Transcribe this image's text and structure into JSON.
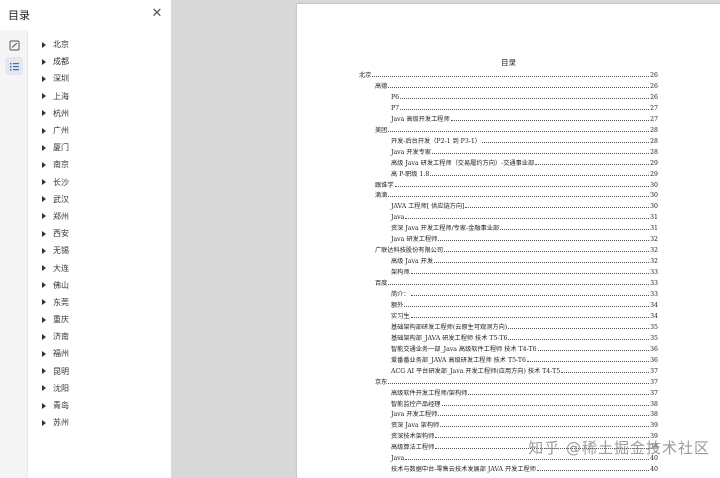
{
  "sidebar": {
    "title": "目录",
    "close_glyph": "✕",
    "tools": [
      {
        "icon": "thumbnail-icon",
        "active": false
      },
      {
        "icon": "outline-icon",
        "active": true
      }
    ],
    "items": [
      {
        "label": "北京"
      },
      {
        "label": "成都"
      },
      {
        "label": "深圳"
      },
      {
        "label": "上海"
      },
      {
        "label": "杭州"
      },
      {
        "label": "广州"
      },
      {
        "label": "厦门"
      },
      {
        "label": "南京"
      },
      {
        "label": "长沙"
      },
      {
        "label": "武汉"
      },
      {
        "label": "郑州"
      },
      {
        "label": "西安"
      },
      {
        "label": "无锡"
      },
      {
        "label": "大连"
      },
      {
        "label": "佛山"
      },
      {
        "label": "东莞"
      },
      {
        "label": "重庆"
      },
      {
        "label": "济南"
      },
      {
        "label": "福州"
      },
      {
        "label": "昆明"
      },
      {
        "label": "沈阳"
      },
      {
        "label": "青岛"
      },
      {
        "label": "苏州"
      }
    ]
  },
  "document": {
    "title": "目录",
    "entries": [
      {
        "text": "北京",
        "page": "26",
        "level": 0
      },
      {
        "text": "高德",
        "page": "26",
        "level": 1
      },
      {
        "text": "P6",
        "page": "26",
        "level": 2
      },
      {
        "text": "P7",
        "page": "27",
        "level": 2
      },
      {
        "text": "Java 高级开发工程师",
        "page": "27",
        "level": 2
      },
      {
        "text": "美团",
        "page": "28",
        "level": 1
      },
      {
        "text": "开发-后台开发（P2-1 到 P3-1）",
        "page": "28",
        "level": 2
      },
      {
        "text": "Java 开发专家",
        "page": "28",
        "level": 2
      },
      {
        "text": "高级 Java 研发工程师（交易履约方向）-交通事业部",
        "page": "29",
        "level": 2
      },
      {
        "text": "高 P-职级 1.8",
        "page": "29",
        "level": 2
      },
      {
        "text": "跟谁学",
        "page": "30",
        "level": 1
      },
      {
        "text": "滴滴",
        "page": "30",
        "level": 1
      },
      {
        "text": "JAVA 工程师[ 供应链方向]",
        "page": "30",
        "level": 2
      },
      {
        "text": "Java",
        "page": "31",
        "level": 2
      },
      {
        "text": "资深 Java 开发工程师/专家-金融事业部",
        "page": "31",
        "level": 2
      },
      {
        "text": "Java 研发工程师",
        "page": "32",
        "level": 2
      },
      {
        "text": "广联达科技股份有限公司",
        "page": "32",
        "level": 1
      },
      {
        "text": "高级 Java 开发",
        "page": "32",
        "level": 2
      },
      {
        "text": "架构师",
        "page": "33",
        "level": 2
      },
      {
        "text": "百度",
        "page": "33",
        "level": 1
      },
      {
        "text": "简介：",
        "page": "33",
        "level": 2
      },
      {
        "text": "额外",
        "page": "34",
        "level": 2
      },
      {
        "text": "实习生",
        "page": "34",
        "level": 2
      },
      {
        "text": "基础架构部研发工程师(云原生可观测方向)",
        "page": "35",
        "level": 2
      },
      {
        "text": "基础架构部_JAVA 研发工程师 技术 T5-T6",
        "page": "35",
        "level": 2
      },
      {
        "text": "智能交通业务一部_Java 高级软件工程师 技术 T4-T6",
        "page": "36",
        "level": 2
      },
      {
        "text": "爱番番业务部_JAVA 高级研发工程师 技术 T5-T6",
        "page": "36",
        "level": 2
      },
      {
        "text": "ACG AI 平台研发部_Java 开发工程师(应用方向) 技术 T4-T5",
        "page": "37",
        "level": 2
      },
      {
        "text": "京东",
        "page": "37",
        "level": 1
      },
      {
        "text": "高级软件开发工程师/架构师",
        "page": "37",
        "level": 2
      },
      {
        "text": "智能监控产品经理",
        "page": "38",
        "level": 2
      },
      {
        "text": "Java 开发工程师",
        "page": "38",
        "level": 2
      },
      {
        "text": "资深 Java 架构师",
        "page": "39",
        "level": 2
      },
      {
        "text": "资深技术架构师",
        "page": "39",
        "level": 2
      },
      {
        "text": "高级算法工程师",
        "page": "39",
        "level": 2
      },
      {
        "text": "Java",
        "page": "40",
        "level": 2
      },
      {
        "text": "技术与数据中台-零售云技术发展部 JAVA 开发工程师",
        "page": "40",
        "level": 2
      }
    ]
  },
  "watermark": "知乎 @稀土掘金技术社区"
}
